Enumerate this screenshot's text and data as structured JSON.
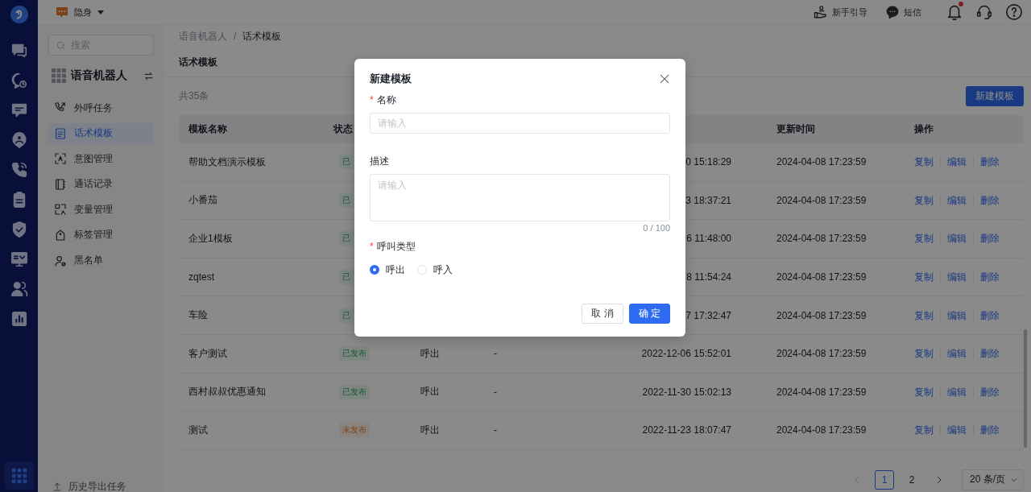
{
  "rail": {
    "items": [
      {
        "kind": "chat",
        "selected": false
      },
      {
        "kind": "chat-clock",
        "selected": false
      },
      {
        "kind": "message",
        "selected": false
      },
      {
        "kind": "user-pin",
        "selected": false
      },
      {
        "kind": "phone",
        "selected": false
      },
      {
        "kind": "clipboard",
        "selected": false
      },
      {
        "kind": "shield",
        "selected": false
      },
      {
        "kind": "monitor",
        "selected": false
      },
      {
        "kind": "users",
        "selected": false
      },
      {
        "kind": "chart",
        "selected": false
      }
    ],
    "bottom": {
      "kind": "apps",
      "selected": true
    }
  },
  "top_bar": {
    "status": "隐身",
    "links": [
      {
        "kind": "guide",
        "label": "新手引导"
      },
      {
        "kind": "sms",
        "label": "短信"
      }
    ],
    "tools": [
      {
        "kind": "bell"
      },
      {
        "kind": "headset"
      },
      {
        "kind": "help"
      }
    ]
  },
  "sidebar": {
    "search": {
      "placeholder": "搜索"
    },
    "title": "语音机器人",
    "items": [
      {
        "kind": "phone-out",
        "label": "外呼任务",
        "selected": false
      },
      {
        "kind": "document",
        "label": "话术模板",
        "selected": true
      },
      {
        "kind": "scan",
        "label": "意图管理",
        "selected": false
      },
      {
        "kind": "notebook",
        "label": "通话记录",
        "selected": false
      },
      {
        "kind": "variable",
        "label": "变量管理",
        "selected": false
      },
      {
        "kind": "tag",
        "label": "标签管理",
        "selected": false
      },
      {
        "kind": "user-block",
        "label": "黑名单",
        "selected": false
      }
    ],
    "footer": "历史导出任务"
  },
  "breadcrumb": {
    "items": [
      "语音机器人",
      "话术模板"
    ],
    "separator": "/"
  },
  "page_title": "话术模板",
  "total": "共35条",
  "new_button": "新建模板",
  "table": {
    "columns": [
      "模板名称",
      "状态",
      "更新时间",
      "操作"
    ],
    "rows": [
      {
        "name": "帮助文档演示模板",
        "status": {
          "kind": "published",
          "text": "已"
        },
        "created": "0 15:18:29",
        "updated": "2024-04-08 17:23:59",
        "actions": [
          "复制",
          "编辑",
          "删除"
        ]
      },
      {
        "name": "小番茄",
        "status": {
          "kind": "published",
          "text": "已"
        },
        "created": "3 18:37:21",
        "updated": "2024-04-08 17:23:59",
        "actions": [
          "复制",
          "编辑",
          "删除"
        ]
      },
      {
        "name": "企业1模板",
        "status": {
          "kind": "published",
          "text": "已"
        },
        "created": "6 11:48:00",
        "updated": "2024-04-08 17:23:59",
        "actions": [
          "复制",
          "编辑",
          "删除"
        ]
      },
      {
        "name": "zqtest",
        "status": {
          "kind": "published",
          "text": "已"
        },
        "created": "8 11:54:24",
        "updated": "2024-04-08 17:23:59",
        "actions": [
          "复制",
          "编辑",
          "删除"
        ]
      },
      {
        "name": "车险",
        "status": {
          "kind": "published",
          "text": "已"
        },
        "created": "7 17:32:47",
        "updated": "2024-04-08 17:23:59",
        "actions": [
          "复制",
          "编辑",
          "删除"
        ]
      },
      {
        "name": "客户测试",
        "status": {
          "kind": "published",
          "text": "已发布"
        },
        "type": "呼出",
        "description": "-",
        "created": "2022-12-06 15:52:01",
        "updated": "2024-04-08 17:23:59",
        "actions": [
          "复制",
          "编辑",
          "删除"
        ]
      },
      {
        "name": "西村叔叔优惠通知",
        "status": {
          "kind": "published",
          "text": "已发布"
        },
        "type": "呼出",
        "description": "-",
        "created": "2022-11-30 15:02:13",
        "updated": "2024-04-08 17:23:59",
        "actions": [
          "复制",
          "编辑",
          "删除"
        ]
      },
      {
        "name": "测试",
        "status": {
          "kind": "unpublished",
          "text": "未发布"
        },
        "type": "呼出",
        "description": "-",
        "created": "2022-11-23 18:07:47",
        "updated": "2024-04-08 17:23:59",
        "actions": [
          "复制",
          "编辑",
          "删除"
        ]
      }
    ]
  },
  "pagination": {
    "pages": [
      {
        "label": "1",
        "selected": true
      },
      {
        "label": "2",
        "selected": false
      }
    ],
    "page_size": "20 条/页"
  },
  "modal": {
    "title": "新建模板",
    "required_mark": "*",
    "fields": [
      {
        "kind": "input",
        "label": "名称",
        "required": true,
        "placeholder": "请输入"
      },
      {
        "kind": "textarea",
        "label": "描述",
        "required": false,
        "placeholder": "请输入",
        "counter": "0 / 100"
      },
      {
        "kind": "radio",
        "label": "呼叫类型",
        "required": true,
        "options": [
          {
            "label": "呼出",
            "selected": true
          },
          {
            "label": "呼入",
            "selected": false
          }
        ]
      }
    ],
    "buttons": [
      {
        "kind": "secondary",
        "label": "取 消"
      },
      {
        "kind": "primary",
        "label": "确 定"
      }
    ]
  }
}
